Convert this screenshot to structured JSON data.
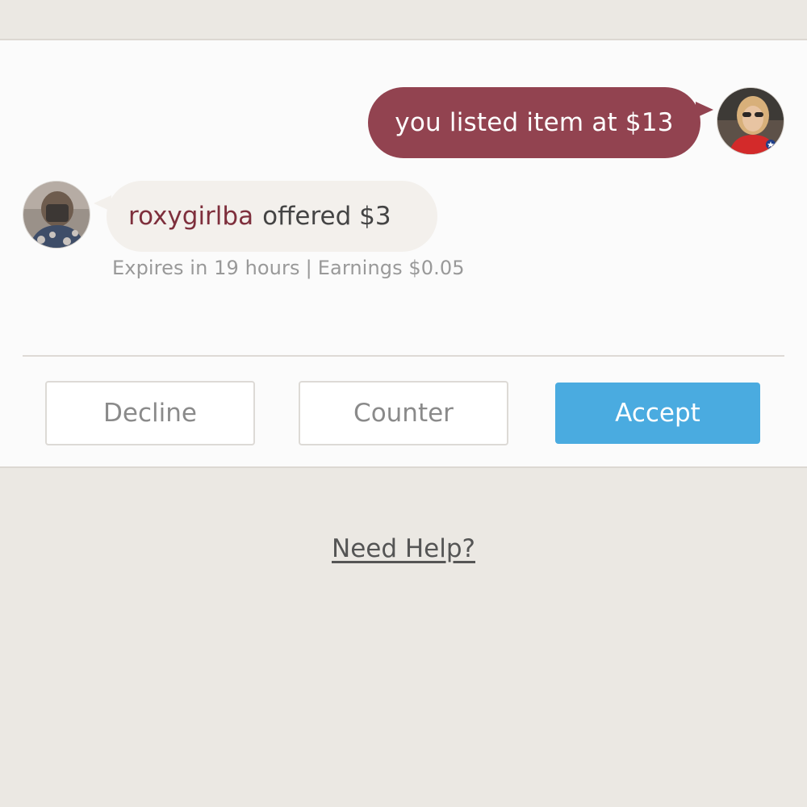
{
  "conversation": {
    "listing_message": "you listed item at $13",
    "offer": {
      "username": "roxygirlba",
      "text": "offered $3",
      "expires": "Expires in 19 hours",
      "separator": "|",
      "earnings": "Earnings $0.05"
    }
  },
  "actions": {
    "decline_label": "Decline",
    "counter_label": "Counter",
    "accept_label": "Accept"
  },
  "footer": {
    "help_link": "Need Help?"
  },
  "colors": {
    "seller_bubble": "#924350",
    "username": "#7e2f3c",
    "accept_button": "#4aabe0",
    "background": "#ebe8e3"
  }
}
